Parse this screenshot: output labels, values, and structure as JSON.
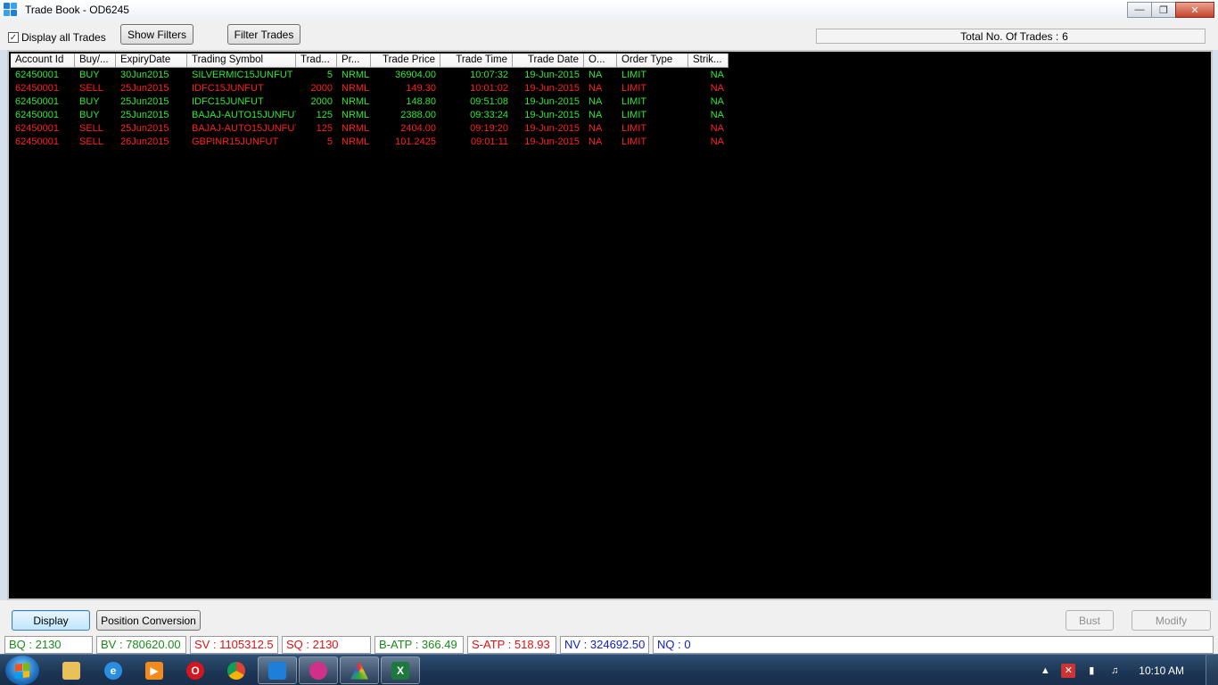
{
  "window": {
    "title": "Trade Book - OD6245"
  },
  "toolbar": {
    "display_all_label": "Display all Trades",
    "display_all_checked": true,
    "show_filters": "Show Filters",
    "filter_trades": "Filter Trades",
    "total_label": "Total No. Of Trades :",
    "total_value": "6"
  },
  "grid": {
    "columns": [
      "Account Id",
      "Buy/...",
      "ExpiryDate",
      "Trading Symbol",
      "Trad...",
      "Pr...",
      "Trade Price",
      "Trade Time",
      "Trade Date",
      "O...",
      "Order Type",
      "Strik..."
    ],
    "rows": [
      {
        "side": "buy",
        "cells": [
          "62450001",
          "BUY",
          "30Jun2015",
          "SILVERMIC15JUNFUT",
          "5",
          "NRML",
          "36904.00",
          "10:07:32",
          "19-Jun-2015",
          "NA",
          "LIMIT",
          "NA"
        ]
      },
      {
        "side": "sell",
        "cells": [
          "62450001",
          "SELL",
          "25Jun2015",
          "IDFC15JUNFUT",
          "2000",
          "NRML",
          "149.30",
          "10:01:02",
          "19-Jun-2015",
          "NA",
          "LIMIT",
          "NA"
        ]
      },
      {
        "side": "buy",
        "cells": [
          "62450001",
          "BUY",
          "25Jun2015",
          "IDFC15JUNFUT",
          "2000",
          "NRML",
          "148.80",
          "09:51:08",
          "19-Jun-2015",
          "NA",
          "LIMIT",
          "NA"
        ]
      },
      {
        "side": "buy",
        "cells": [
          "62450001",
          "BUY",
          "25Jun2015",
          "BAJAJ-AUTO15JUNFUT",
          "125",
          "NRML",
          "2388.00",
          "09:33:24",
          "19-Jun-2015",
          "NA",
          "LIMIT",
          "NA"
        ]
      },
      {
        "side": "sell",
        "cells": [
          "62450001",
          "SELL",
          "25Jun2015",
          "BAJAJ-AUTO15JUNFUT",
          "125",
          "NRML",
          "2404.00",
          "09:19:20",
          "19-Jun-2015",
          "NA",
          "LIMIT",
          "NA"
        ]
      },
      {
        "side": "sell",
        "cells": [
          "62450001",
          "SELL",
          "26Jun2015",
          "GBPINR15JUNFUT",
          "5",
          "NRML",
          "101.2425",
          "09:01:11",
          "19-Jun-2015",
          "NA",
          "LIMIT",
          "NA"
        ]
      }
    ]
  },
  "actions": {
    "display": "Display",
    "position_conversion": "Position Conversion",
    "bust": "Bust",
    "modify": "Modify"
  },
  "status": [
    {
      "text": "BQ : 2130",
      "color": "#1a8a1a"
    },
    {
      "text": "BV : 780620.00",
      "color": "#1a8a1a"
    },
    {
      "text": "SV : 1105312.5",
      "color": "#e01010"
    },
    {
      "text": "SQ : 2130",
      "color": "#e01010"
    },
    {
      "text": "B-ATP : 366.49",
      "color": "#1a8a1a"
    },
    {
      "text": "S-ATP : 518.93",
      "color": "#e01010"
    },
    {
      "text": "NV : 324692.50",
      "color": "#1020c0"
    },
    {
      "text": "NQ : 0",
      "color": "#1020c0"
    }
  ],
  "colors": {
    "buy": "#32e632",
    "sell": "#ff2020",
    "grid_bg": "#000000"
  },
  "taskbar": {
    "items": [
      "explorer-icon",
      "internet-explorer-icon",
      "media-player-icon",
      "opera-icon",
      "chrome-icon",
      "trading-app-icon",
      "app-icon",
      "prism-icon",
      "excel-icon"
    ],
    "clock": "10:10 AM"
  }
}
